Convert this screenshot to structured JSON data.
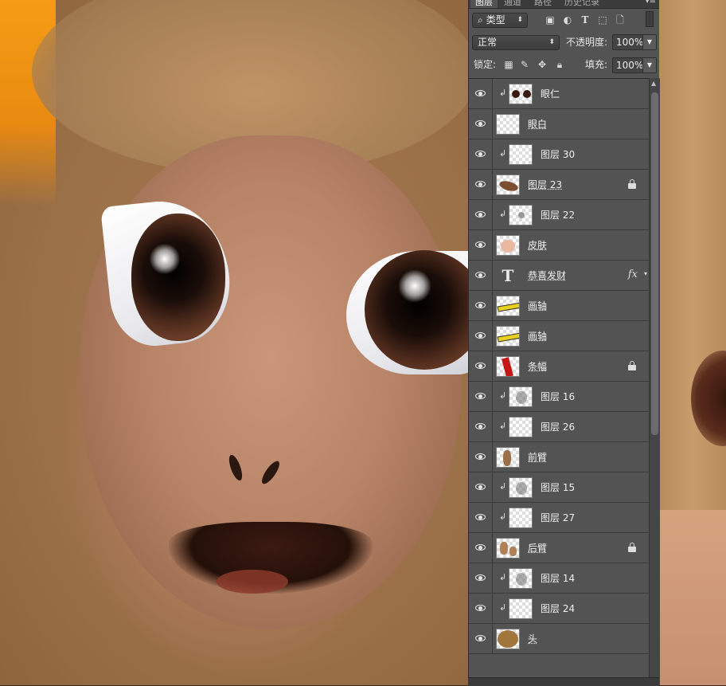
{
  "panel": {
    "tabs": [
      "图层",
      "通道",
      "路径",
      "历史记录"
    ],
    "filter": {
      "label": "类型"
    },
    "filter_icons": [
      "image-filter-icon",
      "adjustment-filter-icon",
      "text-filter-icon",
      "shape-filter-icon",
      "smart-object-filter-icon",
      "filter-toggle-icon"
    ],
    "blend_mode": "正常",
    "opacity_label": "不透明度:",
    "opacity_value": "100%",
    "lock_label": "锁定:",
    "fill_label": "填充:",
    "fill_value": "100%"
  },
  "layers": [
    {
      "name": "眼仁",
      "clipped": true,
      "thumb": "eyes",
      "locked": false
    },
    {
      "name": "眼白",
      "clipped": false,
      "thumb": "empty",
      "locked": false
    },
    {
      "name": "图层 30",
      "clipped": true,
      "thumb": "empty",
      "locked": false
    },
    {
      "name": "图层 23",
      "clipped": false,
      "thumb": "blob-brown",
      "locked": true
    },
    {
      "name": "图层 22",
      "clipped": true,
      "thumb": "dots",
      "locked": false
    },
    {
      "name": "皮肤",
      "clipped": false,
      "thumb": "skin",
      "locked": false
    },
    {
      "name": "恭喜发财",
      "clipped": false,
      "thumb": "text",
      "locked": false,
      "fx": true
    },
    {
      "name": "画轴",
      "clipped": false,
      "thumb": "scroll-yellow",
      "locked": false
    },
    {
      "name": "画轴",
      "clipped": false,
      "thumb": "scroll-yellow",
      "locked": false
    },
    {
      "name": "条幅",
      "clipped": false,
      "thumb": "banner-red",
      "locked": true
    },
    {
      "name": "图层 16",
      "clipped": true,
      "thumb": "smudge",
      "locked": false
    },
    {
      "name": "图层 26",
      "clipped": true,
      "thumb": "empty",
      "locked": false
    },
    {
      "name": "前臂",
      "clipped": false,
      "thumb": "arm",
      "locked": false
    },
    {
      "name": "图层 15",
      "clipped": true,
      "thumb": "smudge",
      "locked": false
    },
    {
      "name": "图层 27",
      "clipped": true,
      "thumb": "empty",
      "locked": false
    },
    {
      "name": "后臂",
      "clipped": false,
      "thumb": "arm2",
      "locked": true
    },
    {
      "name": "图层 14",
      "clipped": true,
      "thumb": "smudge",
      "locked": false
    },
    {
      "name": "图层 24",
      "clipped": true,
      "thumb": "empty",
      "locked": false
    },
    {
      "name": "头",
      "clipped": false,
      "thumb": "head",
      "locked": false
    }
  ],
  "colors": {
    "panel_bg": "#535353",
    "background_orange": "#f59c16",
    "fur": "#a57e55",
    "skin": "#c9967a"
  }
}
